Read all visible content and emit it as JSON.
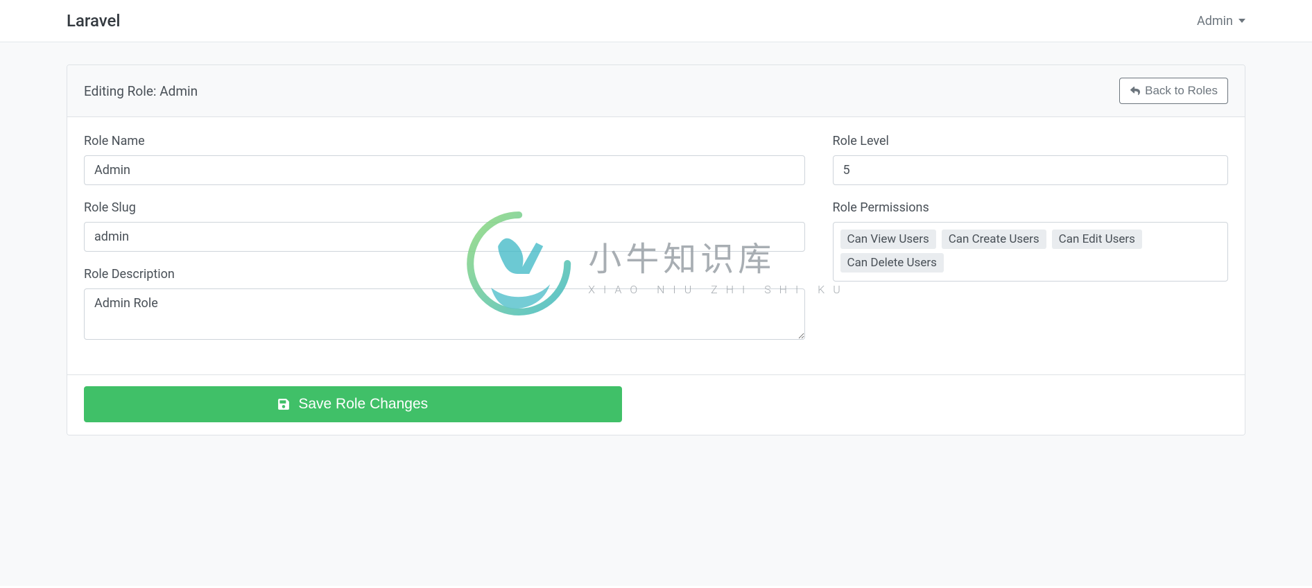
{
  "navbar": {
    "brand": "Laravel",
    "user_label": "Admin"
  },
  "header": {
    "title_prefix": "Editing Role: ",
    "title_role": "Admin",
    "back_button": "Back to Roles"
  },
  "form": {
    "role_name": {
      "label": "Role Name",
      "value": "Admin"
    },
    "role_slug": {
      "label": "Role Slug",
      "value": "admin"
    },
    "role_description": {
      "label": "Role Description",
      "value": "Admin Role"
    },
    "role_level": {
      "label": "Role Level",
      "value": "5"
    },
    "role_permissions": {
      "label": "Role Permissions",
      "items": [
        "Can View Users",
        "Can Create Users",
        "Can Edit Users",
        "Can Delete Users"
      ]
    }
  },
  "footer": {
    "save_button": "Save Role Changes"
  },
  "watermark": {
    "cn": "小牛知识库",
    "en": "XIAO NIU ZHI SHI KU"
  }
}
